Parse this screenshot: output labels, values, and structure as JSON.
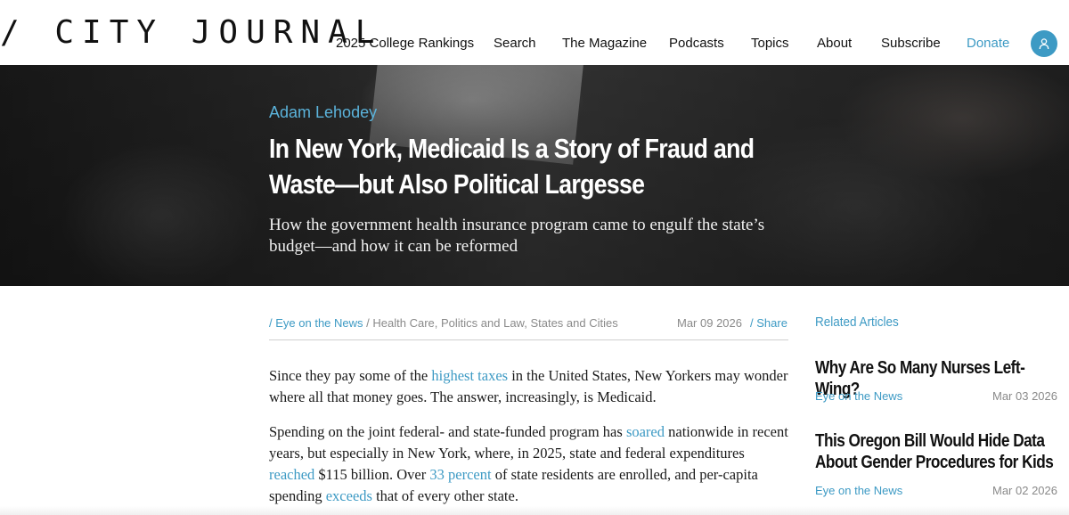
{
  "header": {
    "logo_text": "/ CITY JOURNAL",
    "nav": [
      {
        "label": "2025 College Rankings"
      },
      {
        "label": "Search"
      },
      {
        "label": "The Magazine"
      },
      {
        "label": "Podcasts"
      },
      {
        "label": "Topics"
      },
      {
        "label": "About"
      },
      {
        "label": "Subscribe"
      },
      {
        "label": "Donate"
      }
    ],
    "user_icon": "user-icon"
  },
  "hero": {
    "author": "Adam Lehodey",
    "headline": "In New York, Medicaid Is a Story of Fraud and Waste—but Also Political Largesse",
    "dek": "How the government health insurance program came to engulf the state’s budget—and how it can be reformed"
  },
  "meta": {
    "slash": "/",
    "category": "Eye on the News",
    "tags": "Health Care, Politics and Law, States and Cities",
    "date": "Mar 09 2026",
    "share": "Share"
  },
  "body": {
    "p1": {
      "t1": "Since they pay some of the ",
      "l1": "highest taxes",
      "t2": " in the United States, New Yorkers may wonder where all that money goes. The answer, increasingly, is Medicaid."
    },
    "p2": {
      "t1": "Spending on the joint federal- and state-funded program has ",
      "l1": "soared",
      "t2": " nationwide in recent years, but especially in New York, where, in 2025, state and federal expenditures ",
      "l2": "reached",
      "t3": " $115 billion. Over ",
      "l3": "33 percent",
      "t4": " of state residents are enrolled, and per-capita spending ",
      "l4": "exceeds",
      "t5": " that of every other state."
    }
  },
  "sidebar": {
    "title": "Related Articles",
    "articles": [
      {
        "title": "Why Are So Many Nurses Left-Wing?",
        "category": "Eye on the News",
        "date": "Mar 03 2026"
      },
      {
        "title": "This Oregon Bill Would Hide Data About Gender Procedures for Kids",
        "category": "Eye on the News",
        "date": "Mar 02 2026"
      }
    ]
  },
  "colors": {
    "accent": "#3d9ac4",
    "hero_author": "#5bb3db"
  }
}
